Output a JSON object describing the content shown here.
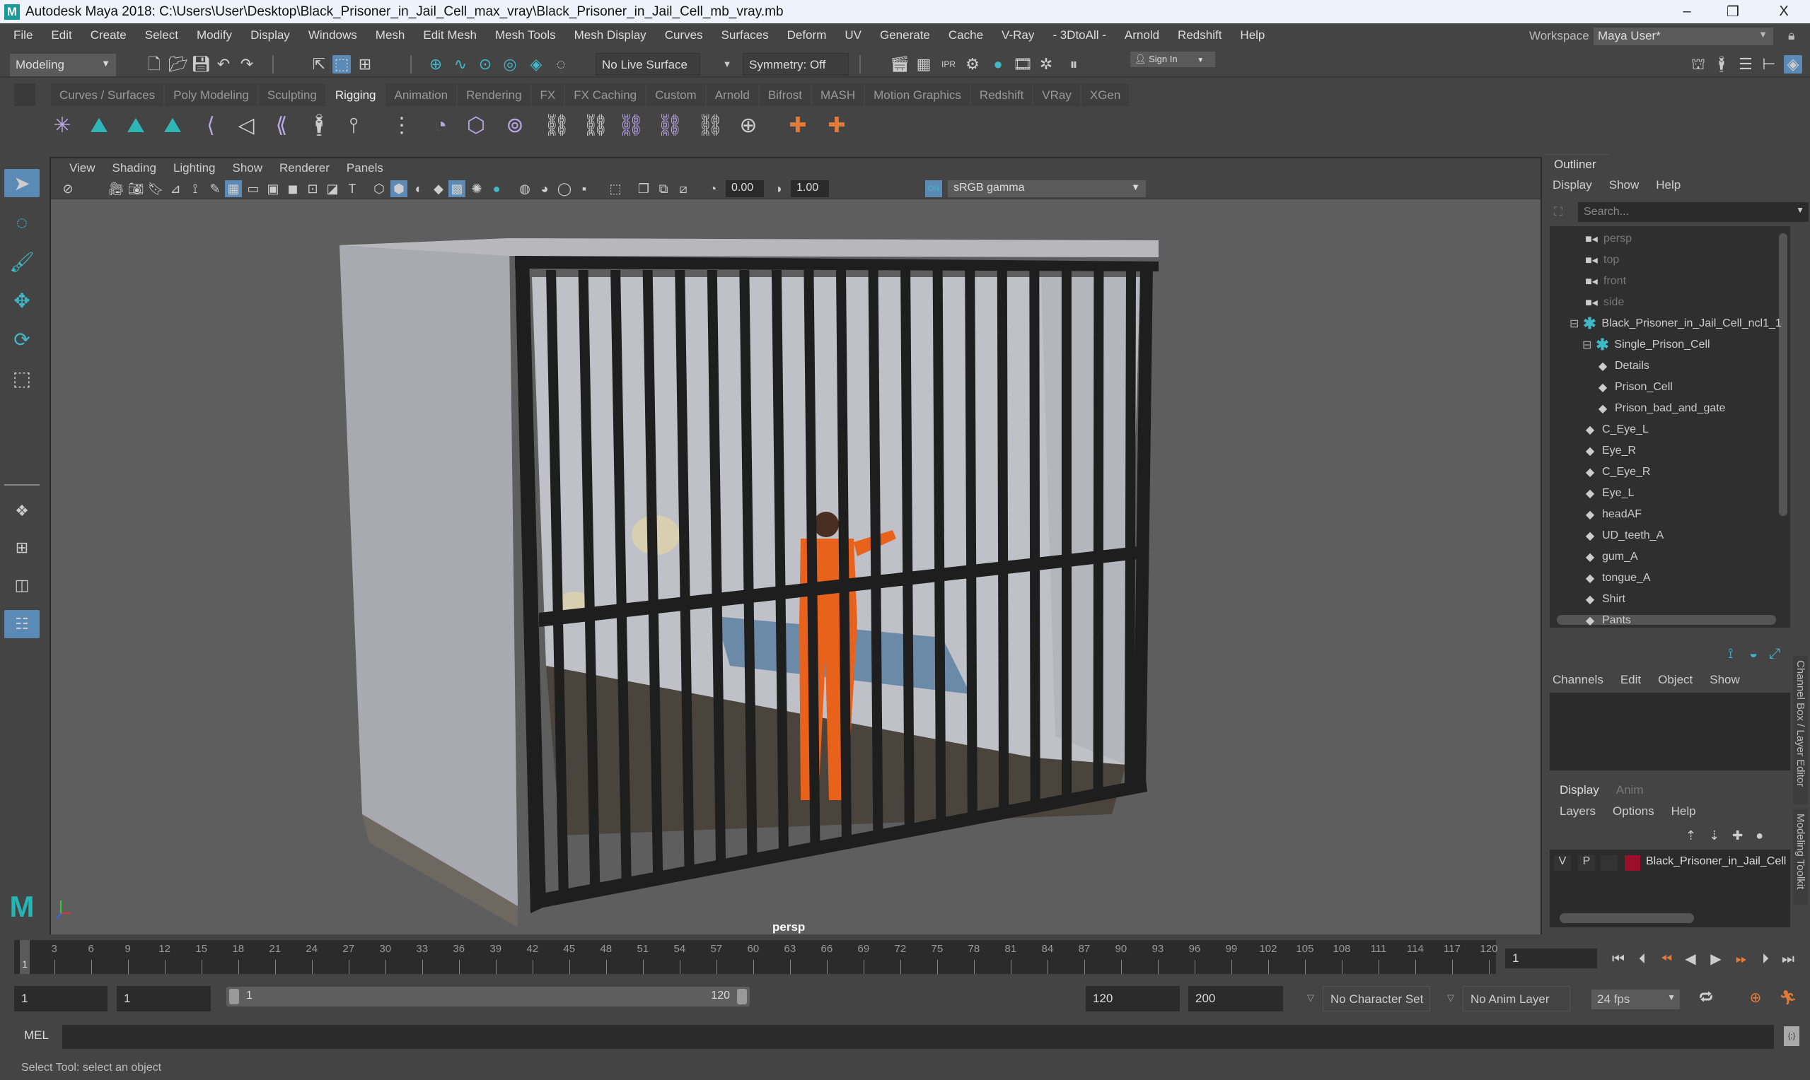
{
  "window": {
    "title": "Autodesk Maya 2018: C:\\Users\\User\\Desktop\\Black_Prisoner_in_Jail_Cell_max_vray\\Black_Prisoner_in_Jail_Cell_mb_vray.mb",
    "minimize": "–",
    "maximize": "❐",
    "close": "X"
  },
  "menubar": [
    "File",
    "Edit",
    "Create",
    "Select",
    "Modify",
    "Display",
    "Windows",
    "Mesh",
    "Edit Mesh",
    "Mesh Tools",
    "Mesh Display",
    "Curves",
    "Surfaces",
    "Deform",
    "UV",
    "Generate",
    "Cache",
    "V-Ray",
    "- 3DtoAll -",
    "Arnold",
    "Redshift",
    "Help"
  ],
  "workspace": {
    "label": "Workspace :",
    "value": "Maya User*"
  },
  "statusline": {
    "mode": "Modeling",
    "live_surface": "No Live Surface",
    "symmetry": "Symmetry: Off",
    "sign_in": "Sign In"
  },
  "shelf": {
    "tabs": [
      "Curves / Surfaces",
      "Poly Modeling",
      "Sculpting",
      "Rigging",
      "Animation",
      "Rendering",
      "FX",
      "FX Caching",
      "Custom",
      "Arnold",
      "Bifrost",
      "MASH",
      "Motion Graphics",
      "Redshift",
      "VRay",
      "XGen"
    ],
    "active_tab": "Rigging",
    "icons": [
      "create-joints-icon",
      "quick-rig-icon",
      "humanik-icon",
      "humanik-define-icon",
      "ik-handle-icon",
      "ik-spline-icon",
      "insert-joint-icon",
      "skeleton-icon",
      "character-controls-icon",
      "bind-skin-icon",
      "smooth-bind-icon",
      "lattice-icon",
      "cluster-icon",
      "parent-constraint-icon",
      "point-constraint-icon",
      "orient-constraint-icon",
      "scale-constraint-icon",
      "aim-constraint-icon",
      "pole-vector-icon",
      "locator-icon",
      "joint-orient-icon"
    ]
  },
  "viewport": {
    "menu": [
      "View",
      "Shading",
      "Lighting",
      "Show",
      "Renderer",
      "Panels"
    ],
    "exposure": "0.00",
    "gamma": "1.00",
    "color_space": "sRGB gamma",
    "camera_label": "persp",
    "axis": {
      "x": "x",
      "y": "y",
      "z": "z"
    }
  },
  "outliner": {
    "title": "Outliner",
    "menu": [
      "Display",
      "Show",
      "Help"
    ],
    "search_placeholder": "Search...",
    "items": [
      {
        "label": "persp",
        "type": "camera",
        "depth": 0
      },
      {
        "label": "top",
        "type": "camera",
        "depth": 0
      },
      {
        "label": "front",
        "type": "camera",
        "depth": 0
      },
      {
        "label": "side",
        "type": "camera",
        "depth": 0
      },
      {
        "label": "Black_Prisoner_in_Jail_Cell_ncl1_1",
        "type": "group",
        "depth": 0,
        "expanded": true
      },
      {
        "label": "Single_Prison_Cell",
        "type": "group",
        "depth": 1,
        "expanded": true
      },
      {
        "label": "Details",
        "type": "mesh",
        "depth": 2
      },
      {
        "label": "Prison_Cell",
        "type": "mesh",
        "depth": 2
      },
      {
        "label": "Prison_bad_and_gate",
        "type": "mesh",
        "depth": 2
      },
      {
        "label": "C_Eye_L",
        "type": "mesh",
        "depth": 1
      },
      {
        "label": "Eye_R",
        "type": "mesh",
        "depth": 1
      },
      {
        "label": "C_Eye_R",
        "type": "mesh",
        "depth": 1
      },
      {
        "label": "Eye_L",
        "type": "mesh",
        "depth": 1
      },
      {
        "label": "headAF",
        "type": "mesh",
        "depth": 1
      },
      {
        "label": "UD_teeth_A",
        "type": "mesh",
        "depth": 1
      },
      {
        "label": "gum_A",
        "type": "mesh",
        "depth": 1
      },
      {
        "label": "tongue_A",
        "type": "mesh",
        "depth": 1
      },
      {
        "label": "Shirt",
        "type": "mesh",
        "depth": 1
      },
      {
        "label": "Pants",
        "type": "mesh",
        "depth": 1
      }
    ]
  },
  "channel_box": {
    "menu": [
      "Channels",
      "Edit",
      "Object",
      "Show"
    ]
  },
  "layer_editor": {
    "tabs": [
      "Display",
      "Anim"
    ],
    "active_tab": "Display",
    "menu": [
      "Layers",
      "Options",
      "Help"
    ],
    "layers": [
      {
        "v": "V",
        "p": "P",
        "color": "#9b0f2a",
        "name": "Black_Prisoner_in_Jail_Cell"
      }
    ]
  },
  "side_tabs": [
    "Channel Box / Layer Editor",
    "Modeling Toolkit"
  ],
  "timeline": {
    "ticks": [
      3,
      6,
      9,
      12,
      15,
      18,
      21,
      24,
      27,
      30,
      33,
      36,
      39,
      42,
      45,
      48,
      51,
      54,
      57,
      60,
      63,
      66,
      69,
      72,
      75,
      78,
      81,
      84,
      87,
      90,
      93,
      96,
      99,
      102,
      105,
      108,
      111,
      114,
      117,
      120
    ],
    "current_frame": "1",
    "current_frame_field": "1"
  },
  "range": {
    "start": "1",
    "playback_start": "1",
    "slider_start": "1",
    "slider_end": "120",
    "playback_end": "120",
    "end": "200",
    "character_set": "No Character Set",
    "anim_layer": "No Anim Layer",
    "fps": "24 fps"
  },
  "command_line": {
    "label": "MEL",
    "value": ""
  },
  "help_line": "Select Tool: select an object"
}
